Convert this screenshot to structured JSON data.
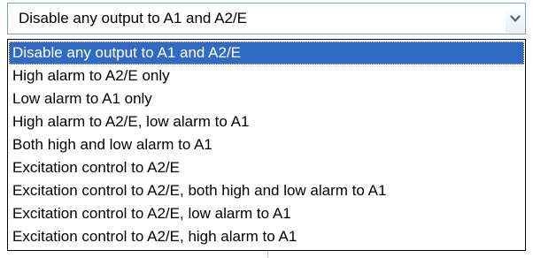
{
  "combo": {
    "selected_value": "Disable any output to A1 and A2/E",
    "button_icon": "chevron-down-icon"
  },
  "dropdown": {
    "selected_index": 0,
    "items": [
      {
        "label": "Disable any output to A1 and A2/E"
      },
      {
        "label": "High alarm to A2/E only"
      },
      {
        "label": "Low alarm to A1 only"
      },
      {
        "label": "High alarm to A2/E, low alarm to A1"
      },
      {
        "label": "Both high and low alarm to A1"
      },
      {
        "label": "Excitation control to A2/E"
      },
      {
        "label": "Excitation control to A2/E, both high and low alarm to A1"
      },
      {
        "label": "Excitation control to A2/E, low alarm to A1"
      },
      {
        "label": "Excitation control to A2/E, high alarm to A1"
      }
    ]
  },
  "colors": {
    "selection_background": "#316ac5",
    "selection_text": "#ffffff",
    "combo_border": "#7f9db9",
    "chevron": "#4d6185"
  }
}
